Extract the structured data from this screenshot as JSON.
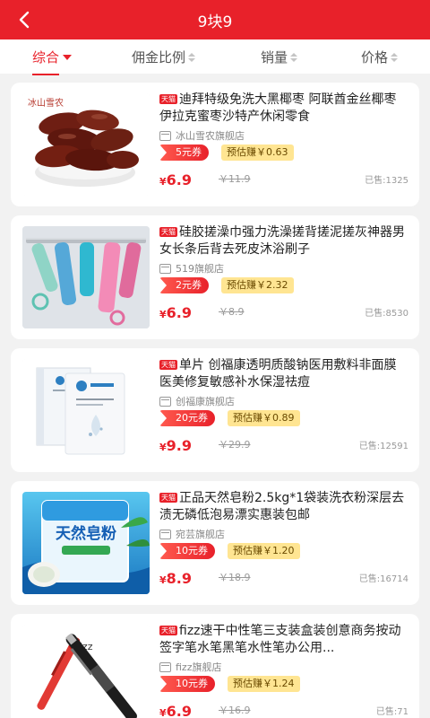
{
  "header": {
    "title": "9块9",
    "back_icon": "chevron-left-icon"
  },
  "sort_tabs": [
    {
      "label": "综合",
      "active": true
    },
    {
      "label": "佣金比例"
    },
    {
      "label": "销量"
    },
    {
      "label": "价格"
    }
  ],
  "colors": {
    "brand_red": "#e8212a",
    "earn_bg": "#ffe592"
  },
  "products": [
    {
      "badge": "天猫",
      "title": "迪拜特级免洗大黑椰枣 阿联酋金丝椰枣伊拉克蜜枣沙特产休闲零食",
      "shop": "冰山雪农旗舰店",
      "coupon": "5元券",
      "earn": "预估赚￥0.63",
      "currency": "¥",
      "price": "6.9",
      "original_price": "￥11.9",
      "sold": "已售:1325",
      "image_text": "冰山雪农"
    },
    {
      "badge": "天猫",
      "title": "硅胶搓澡巾强力洗澡搓背搓泥搓灰神器男女长条后背去死皮沐浴刷子",
      "shop": "519旗舰店",
      "coupon": "2元券",
      "earn": "预估赚￥2.32",
      "currency": "¥",
      "price": "6.9",
      "original_price": "￥8.9",
      "sold": "已售:8530"
    },
    {
      "badge": "天猫",
      "title": "单片 创福康透明质酸钠医用敷料非面膜 医美修复敏感补水保湿祛痘",
      "shop": "创福康旗舰店",
      "coupon": "20元券",
      "earn": "预估赚￥0.89",
      "currency": "¥",
      "price": "9.9",
      "original_price": "￥29.9",
      "sold": "已售:12591"
    },
    {
      "badge": "天猫",
      "title": "正品天然皂粉2.5kg*1袋装洗衣粉深层去渍无磷低泡易漂实惠装包邮",
      "shop": "宛芸旗舰店",
      "coupon": "10元券",
      "earn": "预估赚￥1.20",
      "currency": "¥",
      "price": "8.9",
      "original_price": "￥18.9",
      "sold": "已售:16714",
      "image_text": "天然皂粉"
    },
    {
      "badge": "天猫",
      "title": "fizz速干中性笔三支装盒装创意商务按动签字笔水笔黑笔水性笔办公用...",
      "shop": "fizz旗舰店",
      "coupon": "10元券",
      "earn": "预估赚￥1.24",
      "currency": "¥",
      "price": "6.9",
      "original_price": "￥16.9",
      "sold": "已售:71",
      "image_text": "fizz"
    }
  ]
}
